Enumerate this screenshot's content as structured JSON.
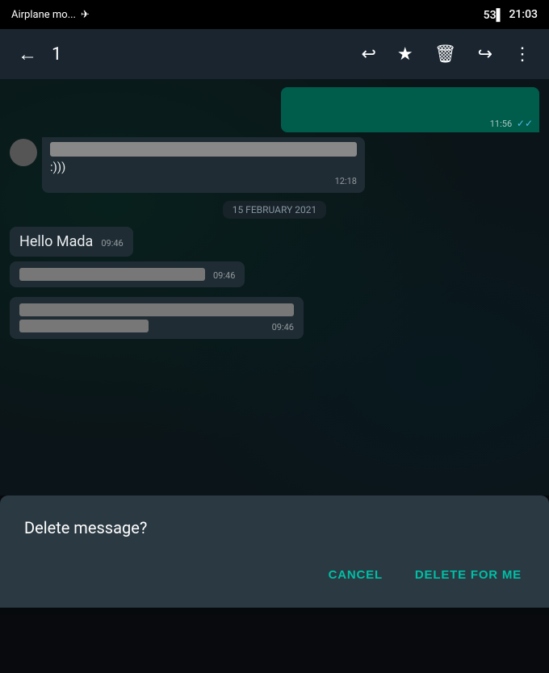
{
  "statusBar": {
    "left": "Airplane mo...",
    "planeIcon": "✈",
    "battery": "53",
    "time": "21:03"
  },
  "toolbar": {
    "count": "1",
    "backIcon": "←",
    "replyIcon": "↩",
    "starIcon": "★",
    "trashIcon": "🗑",
    "forwardIcon": "↪",
    "moreIcon": "⋮"
  },
  "chat": {
    "dateSeparator": "15 FEBRUARY 2021",
    "messages": [
      {
        "type": "outgoing",
        "time": "11:56",
        "hasDoubleCheck": true
      },
      {
        "type": "incoming",
        "text": ":)))",
        "time": "12:18"
      },
      {
        "type": "outgoing-text",
        "text": "Hello Mada",
        "time": "09:46"
      },
      {
        "type": "outgoing-redacted1",
        "time": "09:46"
      },
      {
        "type": "outgoing-redacted2",
        "time": "09:46"
      }
    ]
  },
  "dialog": {
    "title": "Delete message?",
    "cancelLabel": "CANCEL",
    "deleteLabel": "DELETE FOR ME"
  }
}
